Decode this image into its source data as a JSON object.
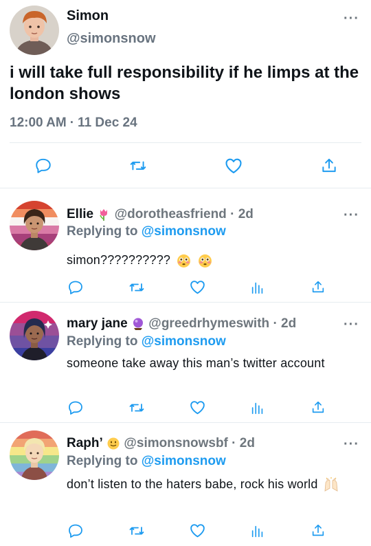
{
  "main_tweet": {
    "display_name": "Simon",
    "handle": "@simonsnow",
    "text": "i will take full responsibility if he limps at the london shows",
    "time": "12:00 AM",
    "date": "11 Dec 24",
    "actions": [
      "reply-icon",
      "retweet-icon",
      "like-icon",
      "share-icon"
    ]
  },
  "replies": [
    {
      "display_name": "Ellie",
      "name_emoji": "tulip",
      "handle": "@dorotheasfriend",
      "age": "2d",
      "replying_prefix": "Replying to",
      "replying_to": "@simonsnow",
      "text": "simon??????????",
      "trailing_emoji": [
        "flushed-face",
        "flushed-face"
      ]
    },
    {
      "display_name": "mary jane",
      "name_emoji": "crystal-ball",
      "handle": "@greedrhymeswith",
      "age": "2d",
      "replying_prefix": "Replying to",
      "replying_to": "@simonsnow",
      "text": "someone take away this man’s twitter account",
      "trailing_emoji": []
    },
    {
      "display_name": "Raph’",
      "name_emoji": "slightly-smiling-face",
      "handle": "@simonsnowsbf",
      "age": "2d",
      "replying_prefix": "Replying to",
      "replying_to": "@simonsnow",
      "text": "don’t listen to the haters babe, rock his world",
      "trailing_emoji": [
        "raising-hands"
      ]
    }
  ],
  "colors": {
    "text": "#0f1419",
    "muted": "#6e767d",
    "link": "#1d9bf0",
    "divider": "#e6ecf0"
  }
}
